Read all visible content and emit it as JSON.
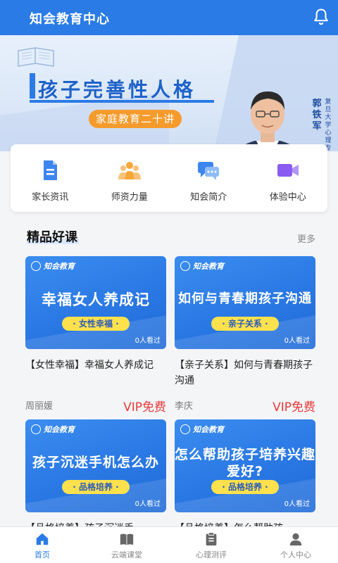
{
  "header": {
    "title": "知会教育中心",
    "icon": "bell-icon"
  },
  "banner": {
    "title": "孩子完善性人格",
    "subtitle": "家庭教育二十讲",
    "person_name": "郭铁军",
    "person_title": "复旦大学心理专家",
    "active_slide": 1,
    "slide_count": 3
  },
  "quick_nav": [
    {
      "label": "家长资讯",
      "icon": "document-icon",
      "color": "#3d86f0"
    },
    {
      "label": "师资力量",
      "icon": "group-icon",
      "color": "#f7a73a"
    },
    {
      "label": "知会简介",
      "icon": "chat-icon",
      "color": "#3d86f0"
    },
    {
      "label": "体验中心",
      "icon": "video-icon",
      "color": "#8a5cf0"
    }
  ],
  "section": {
    "title": "精品好课",
    "more": "更多"
  },
  "courses": [
    {
      "brand": "知会教育",
      "thumb_title": "幸福女人养成记",
      "tag": "· 女性幸福 ·",
      "views": "0人看过",
      "title": "【女性幸福】幸福女人养成记",
      "teacher": "周丽媛",
      "price": "VIP免费"
    },
    {
      "brand": "知会教育",
      "thumb_title": "如何与青春期孩子沟通",
      "tag": "· 亲子关系 ·",
      "views": "0人看过",
      "title": "【亲子关系】如何与青春期孩子沟通",
      "teacher": "李庆",
      "price": "VIP免费"
    },
    {
      "brand": "知会教育",
      "thumb_title": "孩子沉迷手机怎么办",
      "tag": "· 品格培养 ·",
      "views": "0人看过",
      "title": "【品格培养】孩子沉迷手",
      "teacher": "",
      "price": ""
    },
    {
      "brand": "知会教育",
      "thumb_title": "怎么帮助孩子培养兴趣爱好?",
      "tag": "· 品格培养 ·",
      "views": "0人看过",
      "title": "【品格培养】怎么帮助孩",
      "teacher": "",
      "price": ""
    }
  ],
  "tabbar": [
    {
      "label": "首页",
      "icon": "home-icon",
      "active": true
    },
    {
      "label": "云端课堂",
      "icon": "book-icon",
      "active": false
    },
    {
      "label": "心理测评",
      "icon": "clipboard-icon",
      "active": false
    },
    {
      "label": "个人中心",
      "icon": "user-icon",
      "active": false
    }
  ],
  "colors": {
    "primary": "#2a7be6",
    "accent": "#f59b2c",
    "vip": "#e83a3a",
    "tag_bg": "#ffe14d"
  }
}
